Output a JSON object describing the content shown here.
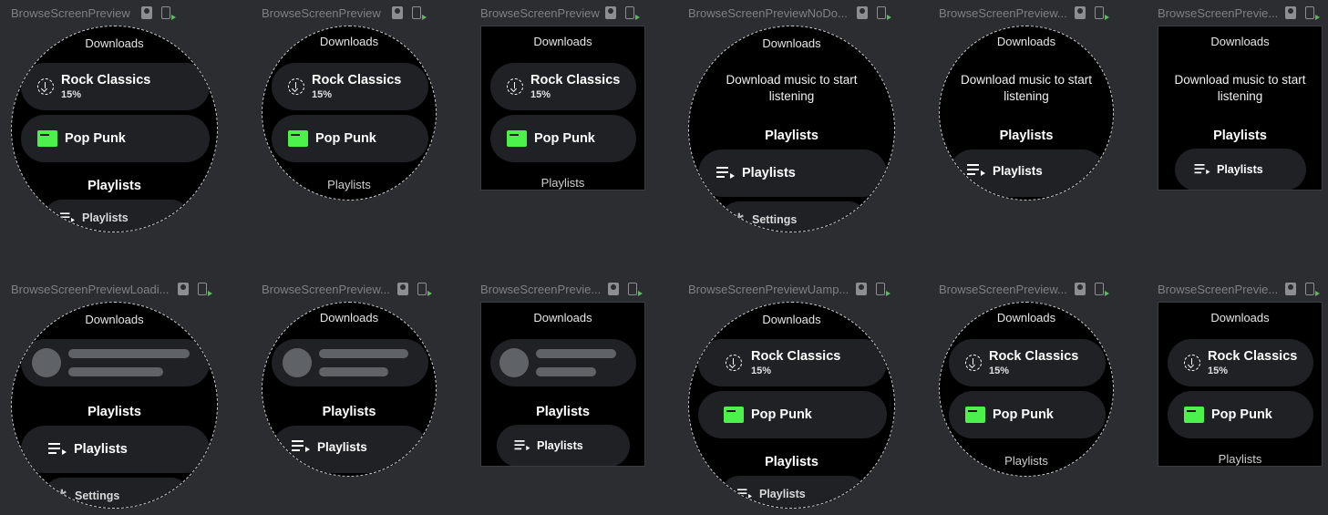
{
  "labels": {
    "downloads": "Downloads",
    "playlists_section": "Playlists",
    "playlists_chip": "Playlists",
    "settings": "Settings",
    "empty_message": "Download music to start listening"
  },
  "items": {
    "rock_name": "Rock Classics",
    "rock_progress": "15%",
    "pop_name": "Pop Punk"
  },
  "colors": {
    "background": "#2b2d30",
    "screen": "#000000",
    "chip": "#202124",
    "album_accent": "#4cf14c"
  },
  "cells": [
    {
      "title": "BrowseScreenPreview"
    },
    {
      "title": "BrowseScreenPreview"
    },
    {
      "title": "BrowseScreenPreview"
    },
    {
      "title": "BrowseScreenPreviewNoDo..."
    },
    {
      "title": "BrowseScreenPreview..."
    },
    {
      "title": "BrowseScreenPrevie..."
    },
    {
      "title": "BrowseScreenPreviewLoadi..."
    },
    {
      "title": "BrowseScreenPreview..."
    },
    {
      "title": "BrowseScreenPrevie..."
    },
    {
      "title": "BrowseScreenPreviewUamp..."
    },
    {
      "title": "BrowseScreenPreview..."
    },
    {
      "title": "BrowseScreenPrevie..."
    }
  ]
}
